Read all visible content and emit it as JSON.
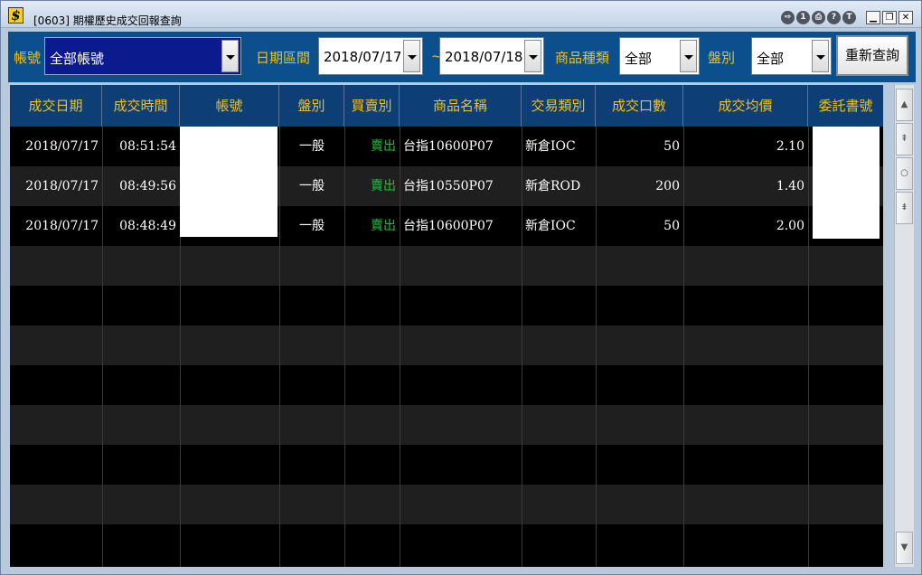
{
  "window": {
    "title": "[0603] 期權歷史成交回報查詢",
    "app_icon_label": "$",
    "title_buttons": [
      "1",
      "?",
      "T"
    ]
  },
  "toolbar": {
    "account_label": "帳號",
    "account_value": "全部帳號",
    "date_label": "日期區間",
    "date_from": "2018/07/17",
    "date_sep": "~",
    "date_to": "2018/07/18",
    "product_label": "商品種類",
    "product_value": "全部",
    "session_label": "盤別",
    "session_value": "全部",
    "refresh_label": "重新查詢"
  },
  "grid": {
    "columns": [
      "成交日期",
      "成交時間",
      "帳號",
      "盤別",
      "買賣別",
      "商品名稱",
      "交易類別",
      "成交口數",
      "成交均價",
      "委託書號"
    ],
    "rows": [
      {
        "date": "2018/07/17",
        "time": "08:51:54",
        "account": "",
        "session": "一般",
        "side": "賣出",
        "product": "台指10600P07",
        "type": "新倉IOC",
        "qty": "50",
        "price": "2.10",
        "order_no": ""
      },
      {
        "date": "2018/07/17",
        "time": "08:49:56",
        "account": "",
        "session": "一般",
        "side": "賣出",
        "product": "台指10550P07",
        "type": "新倉ROD",
        "qty": "200",
        "price": "1.40",
        "order_no": ""
      },
      {
        "date": "2018/07/17",
        "time": "08:48:49",
        "account": "",
        "session": "一般",
        "side": "賣出",
        "product": "台指10600P07",
        "type": "新倉IOC",
        "qty": "50",
        "price": "2.00",
        "order_no": ""
      }
    ]
  },
  "colors": {
    "header_bg": "#0d3e75",
    "header_text": "#f0c020",
    "sell_text": "#19c53a",
    "toolbar_bg": "#0b4f8c"
  }
}
